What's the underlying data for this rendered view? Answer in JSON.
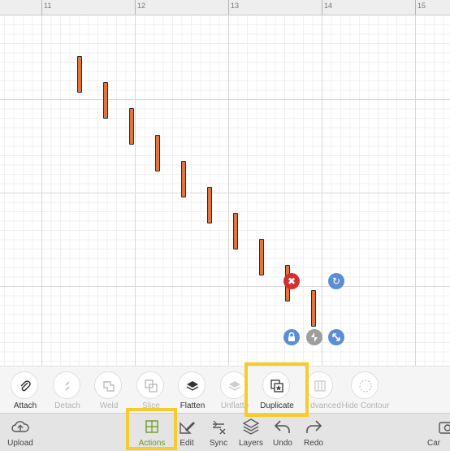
{
  "ruler": {
    "labels": [
      "11",
      "12",
      "13",
      "14",
      "15"
    ]
  },
  "canvas": {
    "shape_count": 10,
    "shape_color": "#e2743f"
  },
  "selection_handles": {
    "delete": {
      "icon": "close-icon",
      "color": "#d32f2f"
    },
    "rotate": {
      "icon": "rotate-icon",
      "color": "#5b8ed6"
    },
    "lock": {
      "icon": "lock-icon",
      "color": "#5b8ed6"
    },
    "flip": {
      "icon": "flip-icon",
      "color": "#9e9e9e"
    },
    "resize": {
      "icon": "resize-icon",
      "color": "#5b8ed6"
    }
  },
  "actions": [
    {
      "label": "Attach",
      "icon": "paperclip-icon",
      "enabled": true
    },
    {
      "label": "Detach",
      "icon": "detach-icon",
      "enabled": false
    },
    {
      "label": "Weld",
      "icon": "weld-icon",
      "enabled": false
    },
    {
      "label": "Slice",
      "icon": "slice-icon",
      "enabled": false
    },
    {
      "label": "Flatten",
      "icon": "flatten-icon",
      "enabled": true
    },
    {
      "label": "Unflatte",
      "icon": "unflatten-icon",
      "enabled": false
    },
    {
      "label": "Duplicate",
      "icon": "duplicate-icon",
      "enabled": true
    },
    {
      "label": "dvanced",
      "icon": "advanced-icon",
      "enabled": false
    },
    {
      "label": "Hide Contour",
      "icon": "hide-contour-icon",
      "enabled": false
    }
  ],
  "toolbar": {
    "upload": "Upload",
    "actions": "Actions",
    "edit": "Edit",
    "sync": "Sync",
    "layers": "Layers",
    "undo": "Undo",
    "redo": "Redo",
    "canvas": "Car"
  },
  "colors": {
    "highlight": "#f6cb2e",
    "active_tool": "#6e9a1f"
  }
}
